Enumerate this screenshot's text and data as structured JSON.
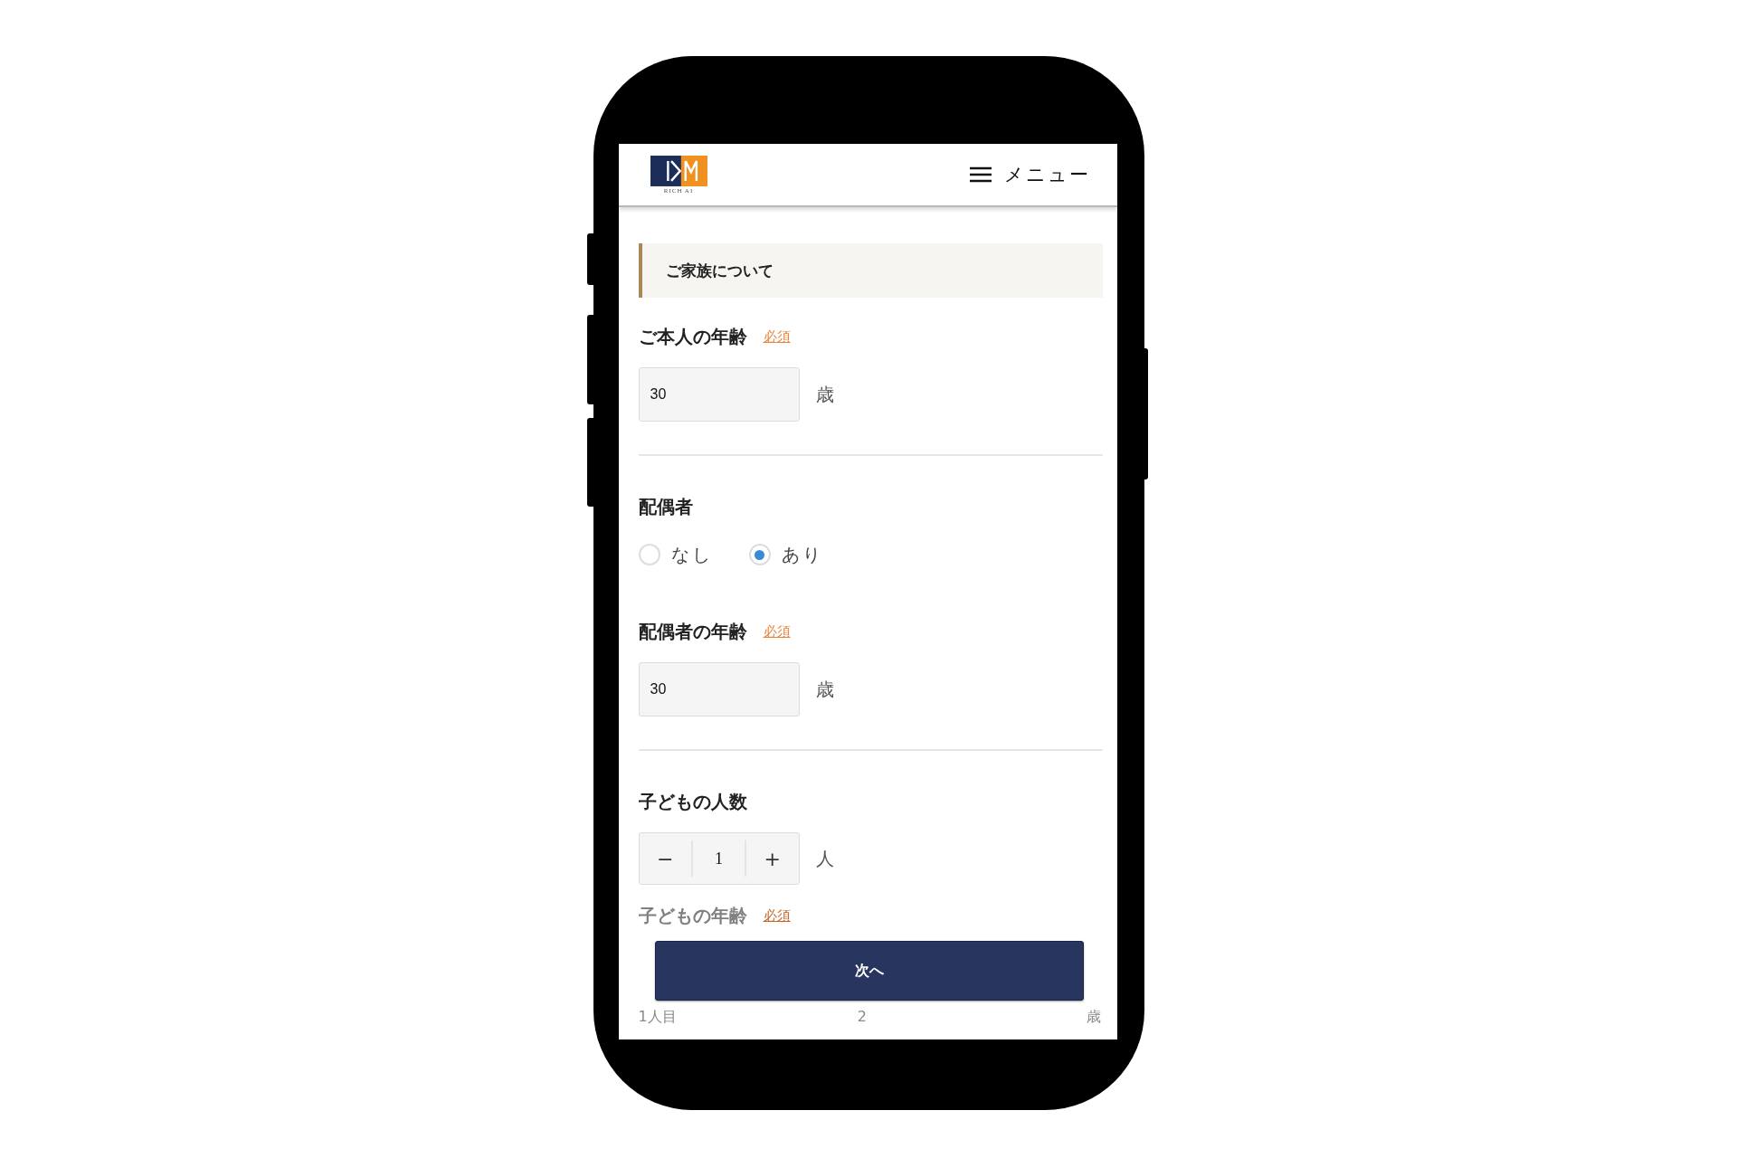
{
  "header": {
    "logo_tagline": "RICH AI",
    "menu_label": "メニュー"
  },
  "section_title": "ご家族について",
  "fields": [
    {
      "kind": "number",
      "label": "ご本人の年齢",
      "required": "必須",
      "value": "30",
      "unit": "歳",
      "divider": true
    },
    {
      "kind": "radio",
      "label": "配偶者",
      "options": [
        {
          "label": "なし",
          "selected": false
        },
        {
          "label": "あり",
          "selected": true
        }
      ]
    },
    {
      "kind": "number",
      "label": "配偶者の年齢",
      "required": "必須",
      "value": "30",
      "unit": "歳",
      "divider": true
    },
    {
      "kind": "stepper",
      "label": "子どもの人数",
      "minus": "−",
      "value": "1",
      "plus": "+",
      "unit": "人"
    }
  ],
  "faded_field": {
    "label": "子どもの年齢",
    "required": "必須",
    "row_label": "1人目",
    "value": "2",
    "unit": "歳"
  },
  "next_button": "次へ"
}
